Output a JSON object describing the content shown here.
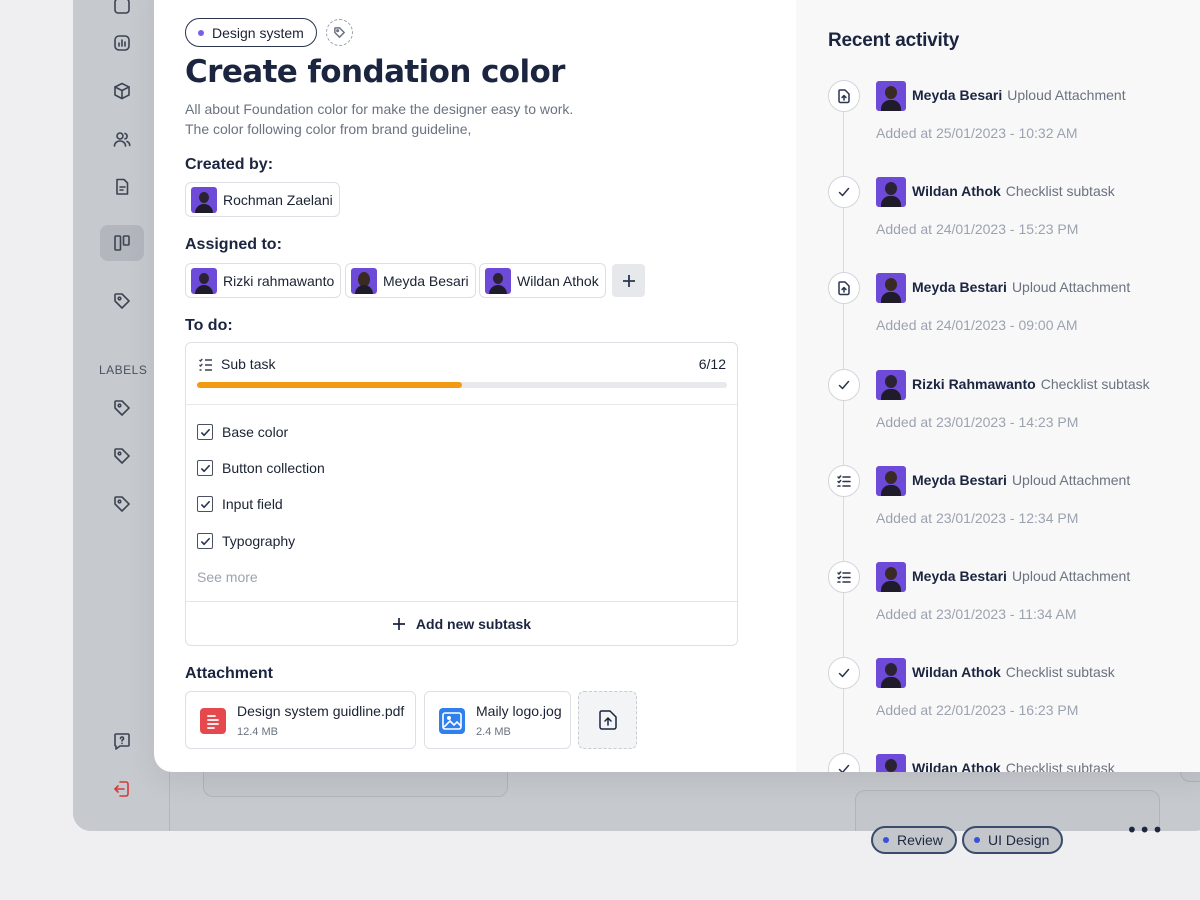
{
  "sidebar": {
    "labels_heading": "LABELS"
  },
  "background": {
    "chips": [
      {
        "label": "Review",
        "dot_color": "#3b50d8"
      },
      {
        "label": "UI Design",
        "dot_color": "#3b50d8"
      }
    ],
    "more_label": "•••"
  },
  "task": {
    "tag": "Design system",
    "title": "Create fondation color",
    "description_line1": "All about Foundation color for make the designer easy to work.",
    "description_line2": "The color following color from brand guideline,",
    "created_by_label": "Created by:",
    "creator": "Rochman Zaelani",
    "assigned_to_label": "Assigned to:",
    "assignees": [
      "Rizki rahmawanto",
      "Meyda Besari",
      "Wildan Athok"
    ],
    "todo_label": "To do:",
    "subtask_label": "Sub task",
    "subtask_count": "6/12",
    "progress": 0.5,
    "checklist": [
      {
        "label": "Base color",
        "checked": true
      },
      {
        "label": "Button collection",
        "checked": true
      },
      {
        "label": "Input field",
        "checked": true
      },
      {
        "label": "Typography",
        "checked": true
      }
    ],
    "see_more": "See more",
    "add_subtask": "Add new subtask",
    "attachment_label": "Attachment",
    "attachments": [
      {
        "name": "Design system guidline.pdf",
        "size": "12.4 MB",
        "icon": "pdf-file-icon",
        "color": "#e5484d"
      },
      {
        "name": "Maily logo.jog",
        "size": "2.4 MB",
        "icon": "image-file-icon",
        "color": "#2f80ed"
      }
    ]
  },
  "activity": {
    "title": "Recent activity",
    "items": [
      {
        "icon": "upload-icon",
        "user": "Meyda Besari",
        "action": "Uploud Attachment",
        "time": "Added at 25/01/2023 - 10:32 AM",
        "avatar": "f"
      },
      {
        "icon": "check-icon",
        "user": "Wildan Athok",
        "action": "Checklist subtask",
        "time": "Added at 24/01/2023 - 15:23 PM",
        "avatar": "m"
      },
      {
        "icon": "upload-icon",
        "user": "Meyda Bestari",
        "action": "Uploud Attachment",
        "time": "Added at 24/01/2023 - 09:00 AM",
        "avatar": "f"
      },
      {
        "icon": "check-icon",
        "user": "Rizki Rahmawanto",
        "action": "Checklist subtask",
        "time": "Added at 23/01/2023 - 14:23 PM",
        "avatar": "m"
      },
      {
        "icon": "list-icon",
        "user": "Meyda Bestari",
        "action": "Uploud Attachment",
        "time": "Added at 23/01/2023 - 12:34 PM",
        "avatar": "f"
      },
      {
        "icon": "list-icon",
        "user": "Meyda Bestari",
        "action": "Uploud Attachment",
        "time": "Added at 23/01/2023 - 11:34 AM",
        "avatar": "f"
      },
      {
        "icon": "check-icon",
        "user": "Wildan Athok",
        "action": "Checklist subtask",
        "time": "Added at 22/01/2023 - 16:23 PM",
        "avatar": "m"
      },
      {
        "icon": "check-icon",
        "user": "Wildan Athok",
        "action": "Checklist subtask",
        "time": "",
        "avatar": "m"
      }
    ]
  },
  "colors": {
    "progress": "#f29a12",
    "accent": "#7c5cf0",
    "danger": "#d33a3a"
  }
}
